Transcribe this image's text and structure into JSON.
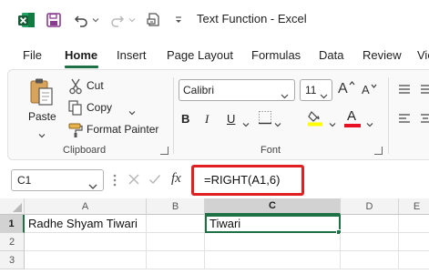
{
  "title_bar": {
    "title": "Text Function  -  Excel"
  },
  "tabs": [
    {
      "label": "File"
    },
    {
      "label": "Home"
    },
    {
      "label": "Insert"
    },
    {
      "label": "Page Layout"
    },
    {
      "label": "Formulas"
    },
    {
      "label": "Data"
    },
    {
      "label": "Review"
    },
    {
      "label": "Vie"
    }
  ],
  "ribbon": {
    "clipboard": {
      "paste": "Paste",
      "cut": "Cut",
      "copy": "Copy",
      "format_painter": "Format Painter",
      "group_label": "Clipboard"
    },
    "font": {
      "font_name": "Calibri",
      "font_size": "11",
      "bold": "B",
      "italic": "I",
      "underline": "U",
      "font_color_letter": "A",
      "grow": "A",
      "shrink": "A",
      "group_label": "Font"
    }
  },
  "formula_bar": {
    "name_box": "C1",
    "fx": "fx",
    "formula": "=RIGHT(A1,6)"
  },
  "grid": {
    "columns": [
      "A",
      "B",
      "C",
      "D",
      "E"
    ],
    "rows": [
      "1",
      "2",
      "3"
    ],
    "cells": {
      "A1": "Radhe Shyam Tiwari",
      "C1": "Tiwari"
    }
  },
  "colors": {
    "excel_green": "#1e7145",
    "highlight_red": "#e02020",
    "font_color_red": "#e81123",
    "fill_yellow": "#ffff00"
  }
}
